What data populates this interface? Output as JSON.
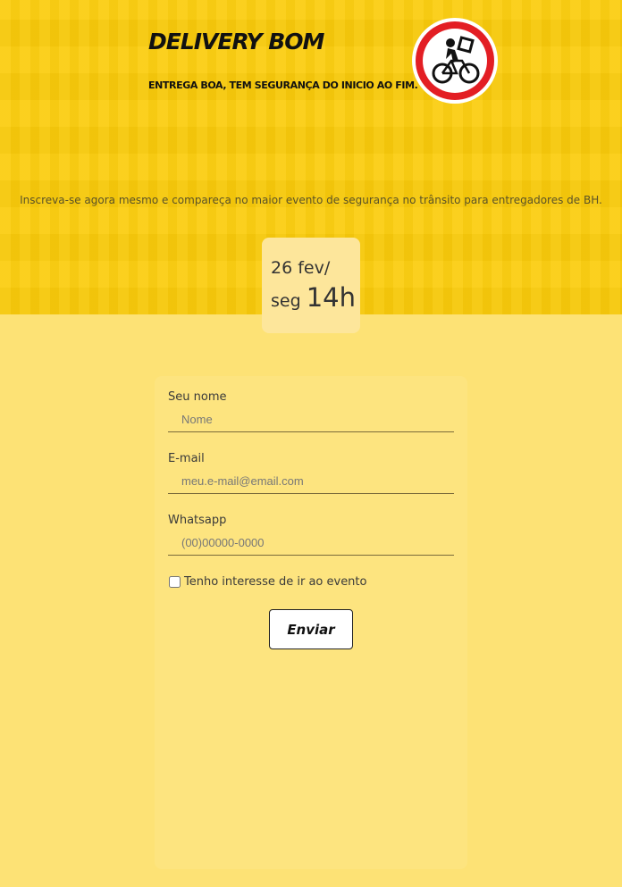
{
  "header": {
    "brand_title": "DELIVERY BOM",
    "tagline": "ENTREGA BOA, TEM SEGURANÇA DO INICIO AO FIM.",
    "logo_icon": "bicycle-delivery-icon"
  },
  "intro": "Inscreva-se agora mesmo e compareça no maior evento de segurança no trânsito para entregadores de BH.",
  "event_date": {
    "date": "26 fev/",
    "weekday": "seg",
    "hour": "14h"
  },
  "form": {
    "name_label": "Seu nome",
    "name_placeholder": "Nome",
    "email_label": "E-mail",
    "email_placeholder": "meu.e-mail@email.com",
    "whatsapp_label": "Whatsapp",
    "whatsapp_placeholder": "(00)00000-0000",
    "interest_checkbox_label": "Tenho interesse de ir ao evento",
    "submit_label": "Enviar"
  },
  "colors": {
    "hero_yellow": "#fbcc0b",
    "page_yellow": "#fde275",
    "logo_red": "#e31e24"
  }
}
